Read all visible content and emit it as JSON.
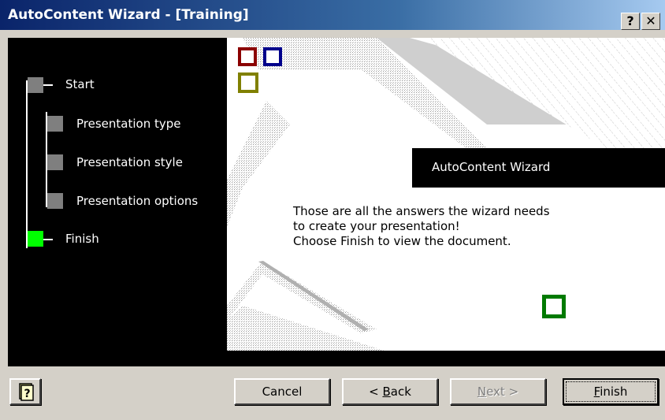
{
  "window": {
    "title": "AutoContent Wizard - [Training]",
    "help_glyph": "?",
    "close_glyph": "✕"
  },
  "steps": [
    {
      "label": "Start",
      "active": false
    },
    {
      "label": "Presentation type",
      "active": false
    },
    {
      "label": "Presentation style",
      "active": false
    },
    {
      "label": "Presentation options",
      "active": false
    },
    {
      "label": "Finish",
      "active": true
    }
  ],
  "content": {
    "heading": "AutoContent Wizard",
    "lines": [
      "Those are all the answers the wizard needs",
      "to create your presentation!",
      "Choose Finish to view the document."
    ]
  },
  "buttons": {
    "cancel": "Cancel",
    "back": "< Back",
    "back_mnemonic": "B",
    "next": "Next >",
    "next_mnemonic": "N",
    "finish": "Finish",
    "finish_mnemonic": "F"
  },
  "colors": {
    "title_bar": "#0a246a",
    "active_step": "#00ff00",
    "inactive_step": "#7f7f7f",
    "square_red": "#8b0000",
    "square_blue": "#00008b",
    "square_olive": "#808000",
    "square_green": "#007a00"
  },
  "icons": {
    "help_button": "help-book-icon"
  }
}
